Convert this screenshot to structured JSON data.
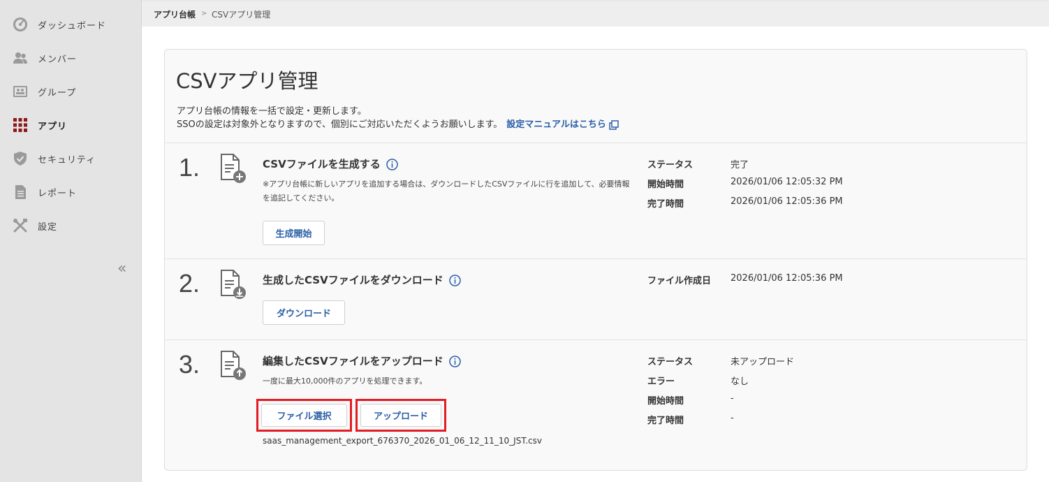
{
  "sidebar": {
    "items": [
      {
        "label": "ダッシュボード",
        "icon": "dashboard-icon"
      },
      {
        "label": "メンバー",
        "icon": "members-icon"
      },
      {
        "label": "グループ",
        "icon": "group-icon"
      },
      {
        "label": "アプリ",
        "icon": "apps-grid-icon",
        "active": true
      },
      {
        "label": "セキュリティ",
        "icon": "shield-icon"
      },
      {
        "label": "レポート",
        "icon": "report-icon"
      },
      {
        "label": "設定",
        "icon": "tools-icon"
      }
    ],
    "collapse_label": "«"
  },
  "breadcrumb": {
    "parent": "アプリ台帳",
    "separator": ">",
    "current": "CSVアプリ管理"
  },
  "page": {
    "title": "CSVアプリ管理",
    "desc1": "アプリ台帳の情報を一括で設定・更新します。",
    "desc2": "SSOの設定は対象外となりますので、個別にご対応いただくようお願いします。",
    "manual_link": "設定マニュアルはこちら"
  },
  "step1": {
    "num": "1.",
    "title": "CSVファイルを生成する",
    "note": "※アプリ台帳に新しいアプリを追加する場合は、ダウンロードしたCSVファイルに行を追加して、必要情報を追記してください。",
    "button": "生成開始",
    "meta": [
      {
        "k": "ステータス",
        "v": "完了"
      },
      {
        "k": "開始時間",
        "v": "2026/01/06 12:05:32 PM"
      },
      {
        "k": "完了時間",
        "v": "2026/01/06 12:05:36 PM"
      }
    ]
  },
  "step2": {
    "num": "2.",
    "title": "生成したCSVファイルをダウンロード",
    "button": "ダウンロード",
    "meta": [
      {
        "k": "ファイル作成日",
        "v": "2026/01/06 12:05:36 PM"
      }
    ]
  },
  "step3": {
    "num": "3.",
    "title": "編集したCSVファイルをアップロード",
    "note": "一度に最大10,000件のアプリを処理できます。",
    "select_button": "ファイル選択",
    "upload_button": "アップロード",
    "filename": "saas_management_export_676370_2026_01_06_12_11_10_JST.csv",
    "meta": [
      {
        "k": "ステータス",
        "v": "未アップロード"
      },
      {
        "k": "エラー",
        "v": "なし"
      },
      {
        "k": "開始時間",
        "v": "-"
      },
      {
        "k": "完了時間",
        "v": "-"
      }
    ]
  },
  "colors": {
    "link": "#2a5fa6",
    "highlight": "#e31b23",
    "active_icon": "#8b1a1a"
  }
}
